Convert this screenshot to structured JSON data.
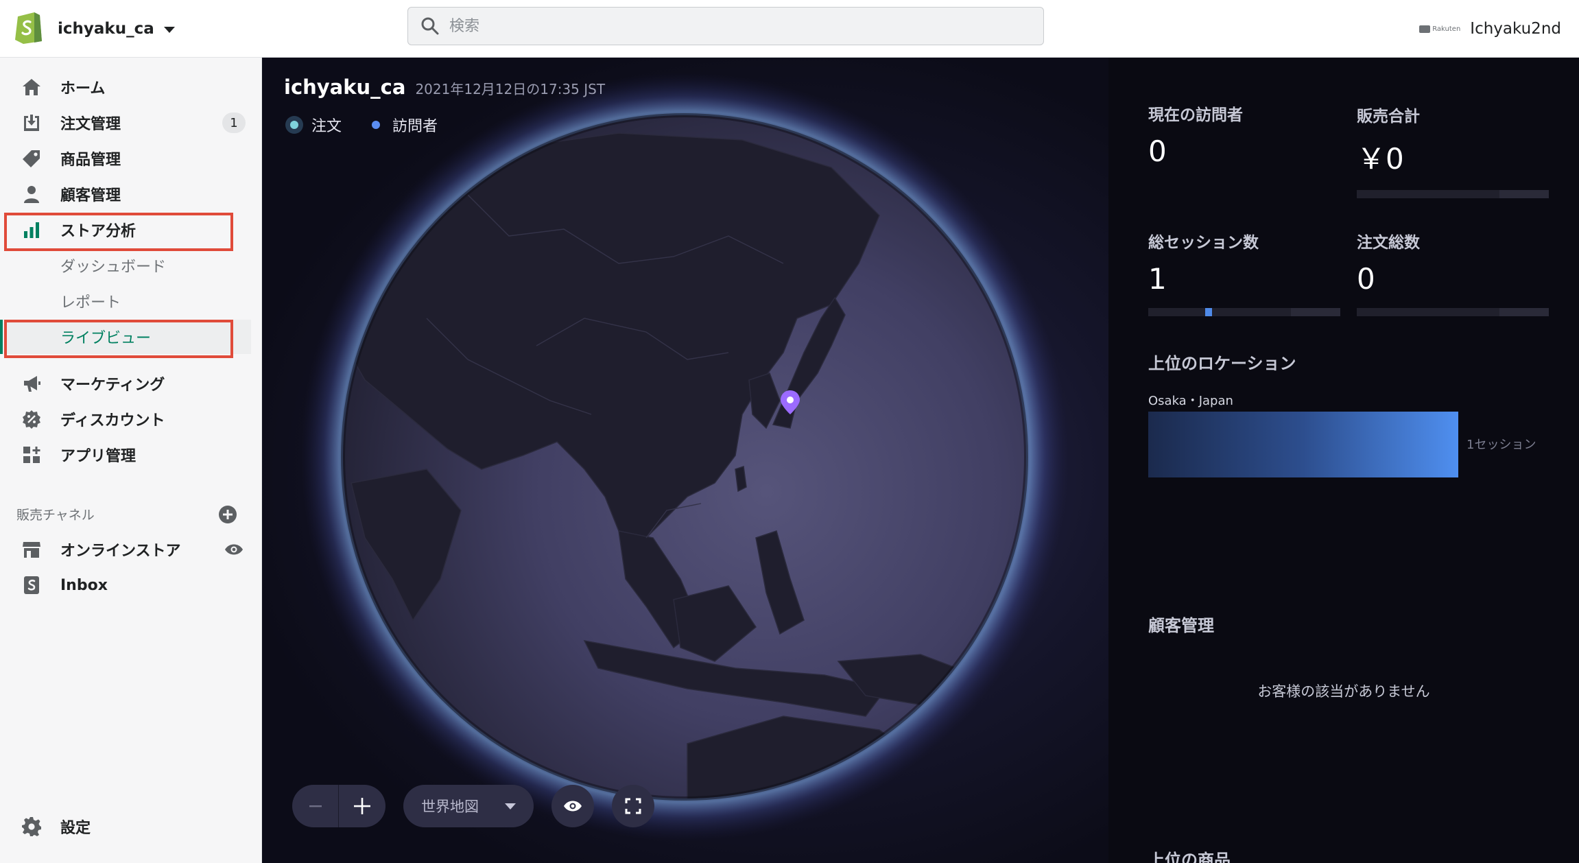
{
  "topbar": {
    "store_name": "ichyaku_ca",
    "search_placeholder": "検索",
    "partner_badge": "Rakuten",
    "account_name": "Ichyaku2nd"
  },
  "sidebar": {
    "items": [
      {
        "label": "ホーム",
        "icon": "home-icon"
      },
      {
        "label": "注文管理",
        "icon": "orders-icon",
        "badge": "1"
      },
      {
        "label": "商品管理",
        "icon": "tag-icon"
      },
      {
        "label": "顧客管理",
        "icon": "customer-icon"
      },
      {
        "label": "ストア分析",
        "icon": "analytics-icon"
      }
    ],
    "analytics_sub": [
      {
        "label": "ダッシュボード"
      },
      {
        "label": "レポート"
      },
      {
        "label": "ライブビュー"
      }
    ],
    "items2": [
      {
        "label": "マーケティング",
        "icon": "megaphone-icon"
      },
      {
        "label": "ディスカウント",
        "icon": "discount-icon"
      },
      {
        "label": "アプリ管理",
        "icon": "apps-icon"
      }
    ],
    "channels_title": "販売チャネル",
    "channels": [
      {
        "label": "オンラインストア",
        "icon": "store-icon"
      },
      {
        "label": "Inbox",
        "icon": "inbox-icon"
      }
    ],
    "settings_label": "設定"
  },
  "live_view": {
    "store_name": "ichyaku_ca",
    "timestamp": "2021年12月12日の17:35 JST",
    "legend_orders": "注文",
    "legend_visitors": "訪問者",
    "map_mode": "世界地図"
  },
  "stats": {
    "current_visitors_label": "現在の訪問者",
    "current_visitors_value": "0",
    "total_sales_label": "販売合計",
    "total_sales_value": "￥0",
    "total_sessions_label": "総セッション数",
    "total_sessions_value": "1",
    "total_orders_label": "注文総数",
    "total_orders_value": "0",
    "top_locations_label": "上位のロケーション",
    "top_location_name": "Osaka・Japan",
    "top_location_count": "1セッション",
    "customers_label": "顧客管理",
    "customers_empty": "お客様の該当がありません",
    "top_products_label": "上位の商品"
  },
  "colors": {
    "accent_green": "#008060",
    "highlight_red": "#e04b3a",
    "visitor_blue": "#5b8df0",
    "pin_purple": "#9b6bff"
  }
}
